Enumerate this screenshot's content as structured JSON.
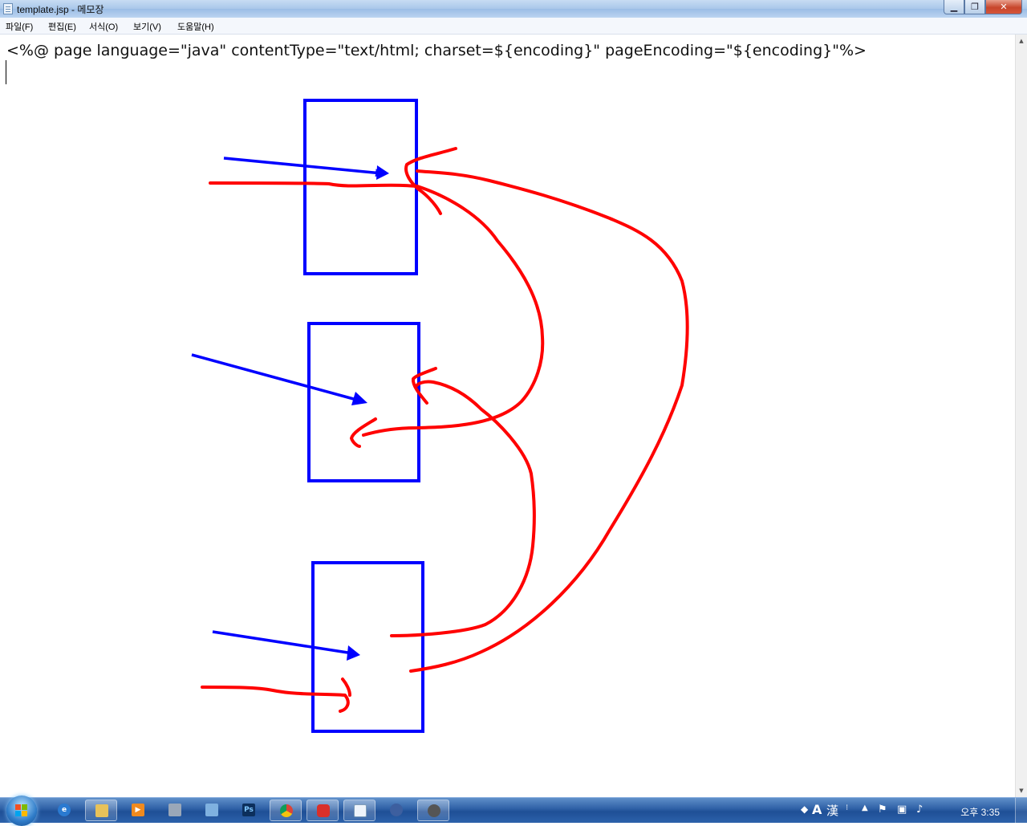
{
  "window": {
    "title": "template.jsp - 메모장",
    "minimize_glyph": "▁",
    "maximize_glyph": "❐",
    "close_glyph": "✕"
  },
  "menu": {
    "items": [
      "파일(F)",
      "편집(E)",
      "서식(O)",
      "보기(V)",
      "도움말(H)"
    ]
  },
  "editor": {
    "text": "<%@ page language=\"java\" contentType=\"text/html; charset=${encoding}\" pageEncoding=\"${encoding}\"%>"
  },
  "drawing": {
    "box_color": "#0000ff",
    "curve_color": "#ff0000",
    "box_count": 3
  },
  "taskbar": {
    "apps": [
      "internet-explorer",
      "windows-explorer",
      "media-player",
      "calculator",
      "notepad-plus",
      "photoshop",
      "chrome",
      "acrobat",
      "notepad",
      "network",
      "settings"
    ],
    "ps_label": "Ps",
    "tray_lang": "A",
    "tray_hanja": "漢",
    "clock": "오후 3:35"
  },
  "colors": {
    "taskbar": "#2d5fa5",
    "titlebar": "#a9c7ea",
    "close_button": "#c7462c"
  }
}
